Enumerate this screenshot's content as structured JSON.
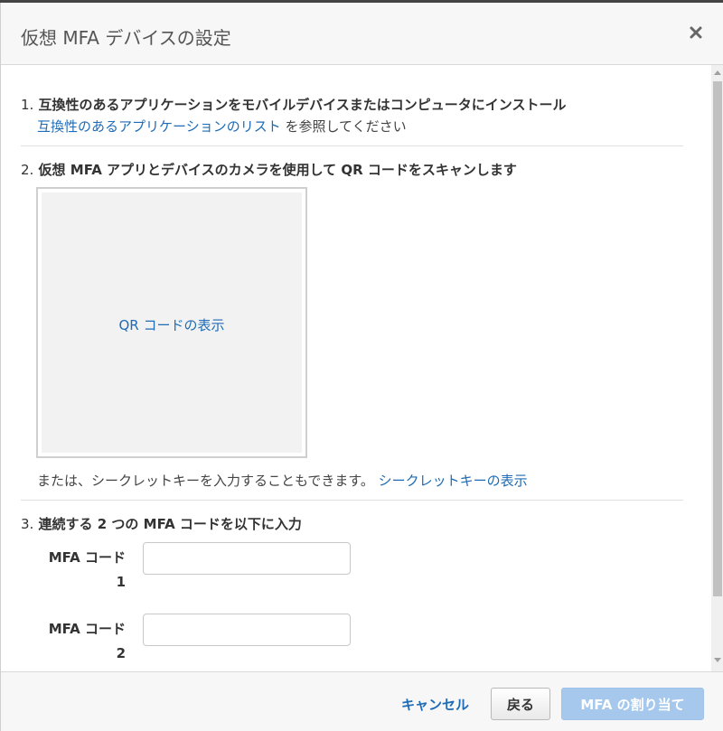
{
  "dialog": {
    "title": "仮想 MFA デバイスの設定"
  },
  "step1": {
    "number": "1.",
    "title": "互換性のあるアプリケーションをモバイルデバイスまたはコンピュータにインストール",
    "link": "互換性のあるアプリケーションのリスト",
    "suffix": " を参照してください"
  },
  "step2": {
    "number": "2.",
    "title": "仮想 MFA アプリとデバイスのカメラを使用して QR コードをスキャンします",
    "qr_link": "QR コードの表示",
    "secret_text": "または、シークレットキーを入力することもできます。 ",
    "secret_link": "シークレットキーの表示"
  },
  "step3": {
    "number": "3.",
    "title": "連続する 2 つの MFA コードを以下に入力",
    "fields": [
      {
        "label_line1": "MFA コード",
        "label_line2": "1",
        "value": "",
        "placeholder": ""
      },
      {
        "label_line1": "MFA コード",
        "label_line2": "2",
        "value": "",
        "placeholder": ""
      }
    ]
  },
  "footer": {
    "cancel_label": "キャンセル",
    "back_label": "戻る",
    "assign_label": "MFA の割り当て"
  },
  "colors": {
    "link": "#1f6bb5",
    "primary_disabled": "#a6c8ec"
  },
  "icons": {
    "close": "close-icon"
  }
}
